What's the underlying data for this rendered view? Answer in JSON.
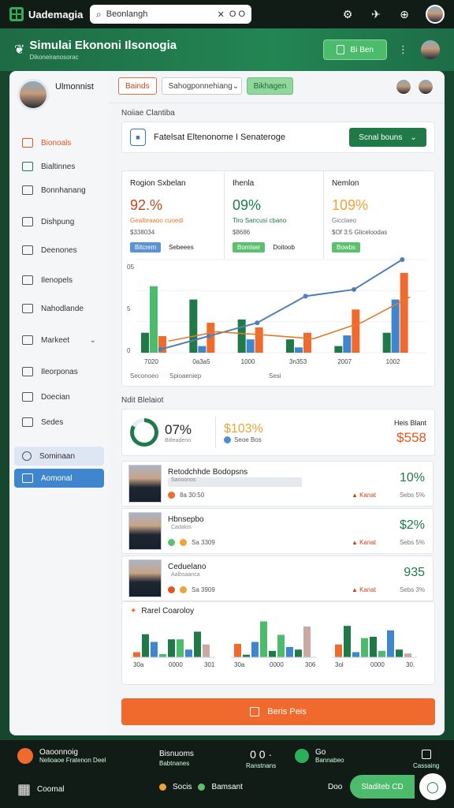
{
  "topbar": {
    "brand": "Uademagia",
    "search_value": "Beonlangh",
    "search_icons": "O O"
  },
  "header": {
    "title": "Simulai Ekononi Ilsonogia",
    "subtitle": "Dikoneiranosorac",
    "button_label": "Bi Ben",
    "more": "⋮"
  },
  "sidebar": {
    "user_name": "Ulmonnist",
    "items": [
      {
        "label": "Bionoals"
      },
      {
        "label": "Bialtinnes"
      },
      {
        "label": "Bonnhanang"
      },
      {
        "label": "Dishpung"
      },
      {
        "label": "Deenones"
      },
      {
        "label": "Ilenopels"
      },
      {
        "label": "Nahodlande"
      },
      {
        "label": "Markeet"
      },
      {
        "label": "Ileorponas"
      },
      {
        "label": "Doecian"
      },
      {
        "label": "Sedes"
      },
      {
        "label": "Sominaan"
      },
      {
        "label": "Aomonal"
      }
    ]
  },
  "main": {
    "tabs": [
      "Bainds",
      "Sahogponnehiang",
      "Bikhagen"
    ],
    "section1_label": "Noiiae Clantiba",
    "search_card_text": "Fatelsat Eltenonome I Senateroge",
    "search_card_button": "Scnal bouns",
    "kpis": [
      {
        "label": "Rogion Sxbelan",
        "value": "92.%",
        "sub": "Gealbraaoo cuoedi",
        "sub2": "$338034",
        "chip": "Bitcrem",
        "chip_text": "Sebeees"
      },
      {
        "label": "Ihenla",
        "value": "09%",
        "sub": "Tiro Sancusi cbano",
        "sub2": "$8686",
        "chip": "Bomiser",
        "chip_text": "Doitoob"
      },
      {
        "label": "Nemlon",
        "value": "109%",
        "sub": "Gicclaeo",
        "sub2": "$Of 3:5 Gliceloodas",
        "chip": "Bowbs",
        "chip_text": ""
      }
    ],
    "section2_label": "Ndit Blelaiot",
    "summary": {
      "donut_value": "07%",
      "donut_caption": "Bitleadeno",
      "mid_value": "$103%",
      "mid_caption": "Seoe Bos",
      "right_label": "Heis Blant",
      "right_value": "$558"
    },
    "people": [
      {
        "name": "Retodchhde Bodopsns",
        "bar": "Sarioonos",
        "meta": "8a 30:50",
        "pct": "10%",
        "rank": "Kanat",
        "rank_val": "Sebs 5%"
      },
      {
        "name": "Hbnsepbo",
        "bar": "Cadalos",
        "meta": "Sa 3309",
        "pct": "$2%",
        "rank": "Kanat",
        "rank_val": "Sebs 5%"
      },
      {
        "name": "Ceduelano",
        "bar": "Aalbsaanca",
        "meta": "Sa 3909",
        "pct": "935",
        "rank": "Kanat",
        "rank_val": "Sebs 3%"
      }
    ],
    "bottom_chart_title": "Rarel Coaroloy",
    "cta_label": "Beris Peis"
  },
  "footer": {
    "left_top": "Oaoonnoig",
    "left_top_sub": "Nelioaoe Fratenon Deel",
    "left_bottom": "Coomal",
    "mid_top": "Bisnuoms",
    "mid_top_sub": "Babtnanes",
    "mid_bottom_a": "Socis",
    "mid_bottom_b": "Bamsant",
    "counter": "0 0 ·",
    "counter_sub": "Ranstnans",
    "go_label": "Go",
    "go_sub": "Bannabeo",
    "box_sub": "Cassaing",
    "bottom_small": "Doo",
    "action_button": "Sladiteb CD"
  },
  "chart_data": [
    {
      "type": "bar",
      "title": "",
      "categories": [
        "7020",
        "0a3a5",
        "1000",
        "3n353",
        "2007",
        "1002"
      ],
      "x_tick_labels": [
        "Seconoeo",
        "Spioaeniep",
        "Sesi"
      ],
      "ytick_labels": [
        "05",
        "5",
        "0"
      ],
      "series": [
        {
          "values": [
            3,
            8,
            5,
            2,
            1,
            3
          ]
        },
        {
          "values": [
            10,
            1,
            2,
            0.8,
            2.6,
            8
          ]
        },
        {
          "values": [
            2.5,
            4.5,
            3.8,
            3,
            6.5,
            12
          ]
        }
      ],
      "line_values": [
        0.5,
        2.5,
        4.5,
        8.5,
        9.5,
        14
      ]
    },
    {
      "type": "bar",
      "title": "Rarel Coaroloy",
      "categories": [
        "30a",
        "0000",
        "301",
        "30a",
        "0000",
        "306",
        "3ol",
        "0000",
        "30."
      ],
      "values": [
        2,
        6,
        3,
        1,
        4,
        7,
        2,
        5,
        4
      ]
    }
  ]
}
